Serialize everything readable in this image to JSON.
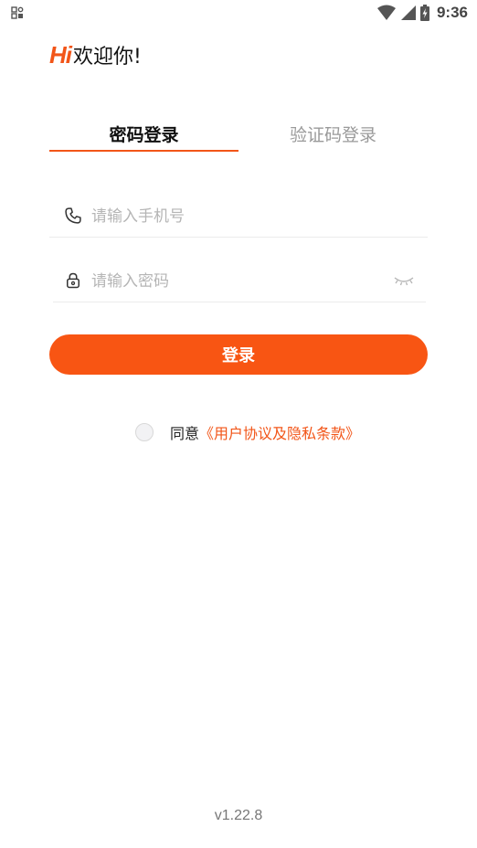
{
  "status_bar": {
    "time": "9:36",
    "left_icon": "notification-grid-icon",
    "right_icons": [
      "wifi-icon",
      "cell-signal-icon",
      "battery-charging-icon"
    ]
  },
  "greeting": {
    "logo_text": "Hi",
    "welcome": "欢迎你!"
  },
  "tabs": [
    {
      "label": "密码登录",
      "active": true
    },
    {
      "label": "验证码登录",
      "active": false
    }
  ],
  "form": {
    "phone": {
      "icon": "phone-icon",
      "placeholder": "请输入手机号",
      "value": ""
    },
    "password": {
      "icon": "lock-icon",
      "placeholder": "请输入密码",
      "value": "",
      "toggle_icon": "eye-closed-icon"
    }
  },
  "login_button": {
    "label": "登录"
  },
  "agreement": {
    "prefix": "同意",
    "link_text": "《用户协议及隐私条款》",
    "checked": false
  },
  "version": "v1.22.8",
  "colors": {
    "accent": "#f25518",
    "button": "#f85513",
    "tab_inactive": "#9a9a9a",
    "placeholder": "#b5b5b5"
  }
}
